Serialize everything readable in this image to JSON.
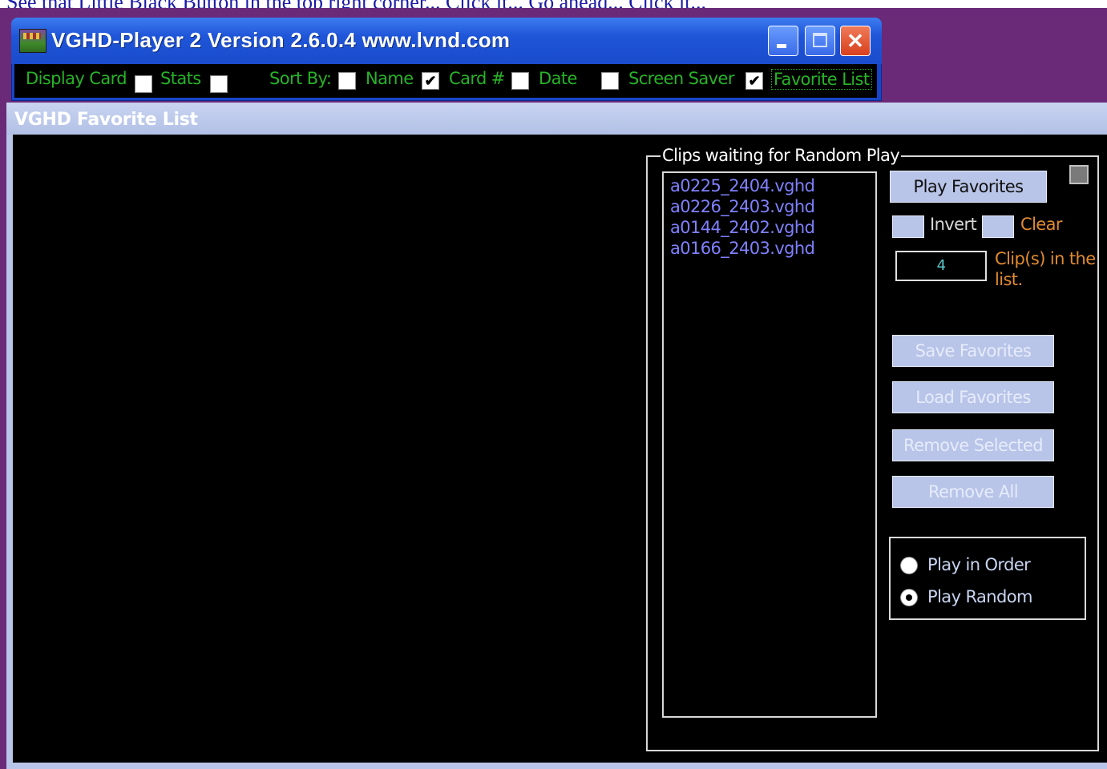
{
  "caption": "See that Little Black Button in the top right corner... Click it... Go ahead... Click it...",
  "player_window": {
    "title": "VGHD-Player 2  Version 2.6.0.4  www.lvnd.com",
    "icon": "vghd-app-icon",
    "buttons": {
      "minimize": "minimize-icon",
      "maximize": "maximize-icon",
      "close": "✕"
    }
  },
  "options": {
    "display_card": {
      "label": "Display Card",
      "checked": false
    },
    "stats": {
      "label": "Stats",
      "checked": false
    },
    "sort_by_label": "Sort By:",
    "sort_by_box_checked": false,
    "name": {
      "label": "Name",
      "checked": true
    },
    "card": {
      "label": "Card #",
      "checked": false
    },
    "date": {
      "label": "Date",
      "checked": false
    },
    "screen_saver": {
      "label": "Screen Saver",
      "checked": true
    },
    "favorite_list": {
      "label": "Favorite List"
    },
    "check_glyph": "✔"
  },
  "favorite_window": {
    "title": "VGHD Favorite List",
    "group_title": "Clips waiting for Random Play",
    "clips": [
      "a0225_2404.vghd",
      "a0226_2403.vghd",
      "a0144_2402.vghd",
      "a0166_2403.vghd"
    ],
    "play_favorites": "Play Favorites",
    "invert": "Invert",
    "clear": "Clear",
    "clip_count": "4",
    "clip_count_label": "Clip(s) in the list.",
    "save_favorites": "Save Favorites",
    "load_favorites": "Load Favorites",
    "remove_selected": "Remove Selected",
    "remove_all": "Remove All",
    "play_in_order": "Play in Order",
    "play_random": "Play Random",
    "selected_mode": "Play Random"
  }
}
